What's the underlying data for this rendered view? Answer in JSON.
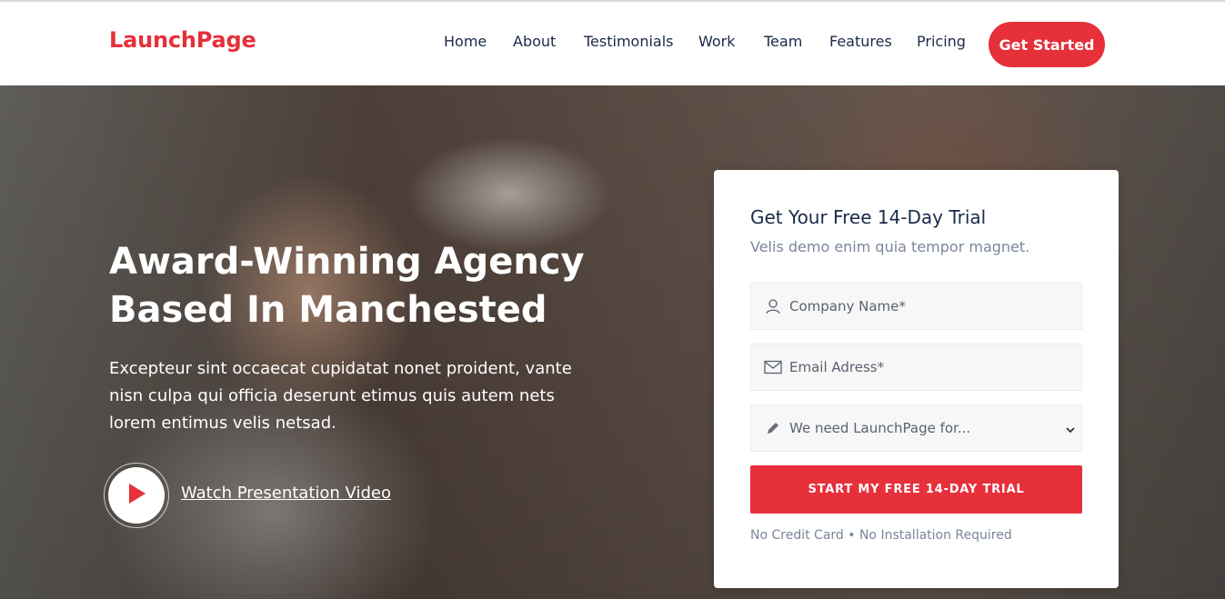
{
  "header": {
    "brand": "LaunchPage",
    "nav": [
      "Home",
      "About",
      "Testimonials",
      "Work",
      "Team",
      "Features",
      "Pricing"
    ],
    "cta": "Get Started"
  },
  "hero": {
    "title_line1": "Award-Winning Agency",
    "title_line2": "Based In Manchested",
    "description": "Excepteur sint occaecat cupidatat nonet proident, vante nisn culpa qui officia deserunt etimus quis autem nets lorem entimus velis netsad.",
    "video_link": "Watch Presentation Video"
  },
  "form": {
    "title": "Get Your Free 14-Day Trial",
    "subtitle": "Velis demo enim quia tempor magnet.",
    "company_placeholder": "Company Name*",
    "email_placeholder": "Email Adress*",
    "need_select": "We need LaunchPage for...",
    "submit": "START MY FREE 14-DAY TRIAL",
    "note": "No Credit Card • No Installation Required"
  },
  "colors": {
    "accent": "#e6303a",
    "nav_text": "#1b2a4a",
    "muted": "#7a8699"
  },
  "icons": {
    "play": "play-icon",
    "user": "user-icon",
    "email": "envelope-icon",
    "pencil": "pencil-icon",
    "select": "chevron-down-icon"
  }
}
